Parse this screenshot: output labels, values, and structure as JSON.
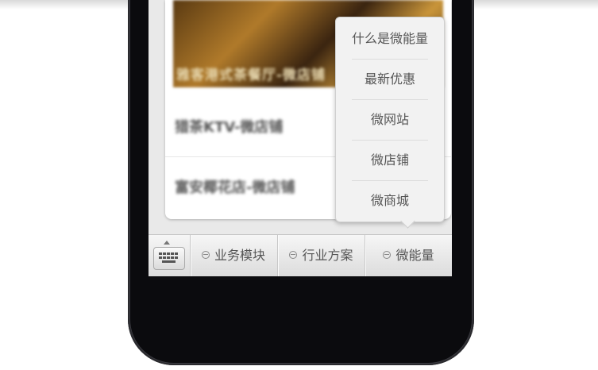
{
  "popup_menu": {
    "items": [
      "什么是微能量",
      "最新优惠",
      "微网站",
      "微店铺",
      "微商城"
    ]
  },
  "background_content": {
    "photo_caption": "雅客港式茶餐厅-微店铺",
    "rows": [
      "猎茶KTV-微店铺",
      "富安椰花店-微店铺"
    ]
  },
  "tabbar": {
    "keyboard_icon": "keyboard-icon",
    "tabs": [
      {
        "label": "业务模块",
        "icon": "dot-icon"
      },
      {
        "label": "行业方案",
        "icon": "dot-icon"
      },
      {
        "label": "微能量",
        "icon": "dot-icon"
      }
    ]
  },
  "colors": {
    "phone_body": "#0b0b0e",
    "tabbar_top": "#f6f6f6",
    "tabbar_bottom": "#dcdcdc",
    "popup_bg": "#f2f2f2",
    "text": "#555555"
  }
}
